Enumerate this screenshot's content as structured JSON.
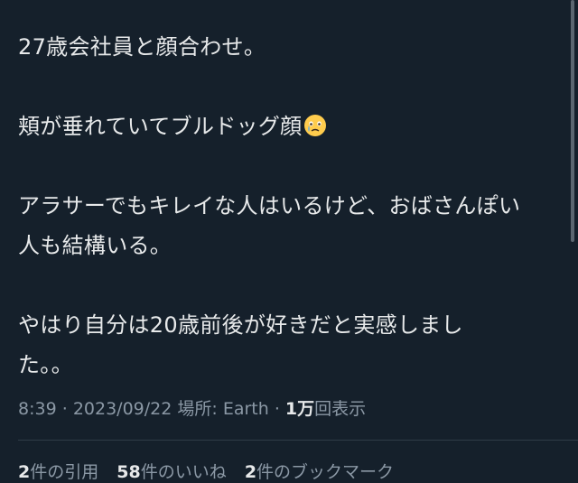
{
  "tweet": {
    "lines": [
      "27歳会社員と顔合わせ。",
      "",
      "頬が垂れていてブルドッグ顔",
      "",
      "アラサーでもキレイな人はいるけど、おばさんぽい",
      "人も結構いる。",
      "",
      "やはり自分は20歳前後が好きだと実感しまし",
      "た。。"
    ],
    "emoji": "face-holding-back-tears-icon"
  },
  "meta": {
    "time": "8:39",
    "separator": "·",
    "date": "2023/09/22",
    "location": "場所: Earth",
    "views_count": "1万",
    "views_label": "回表示"
  },
  "stats": {
    "quotes": {
      "count": "2",
      "label": "件の引用"
    },
    "likes": {
      "count": "58",
      "label": "件のいいね"
    },
    "bookmarks": {
      "count": "2",
      "label": "件のブックマーク"
    }
  }
}
